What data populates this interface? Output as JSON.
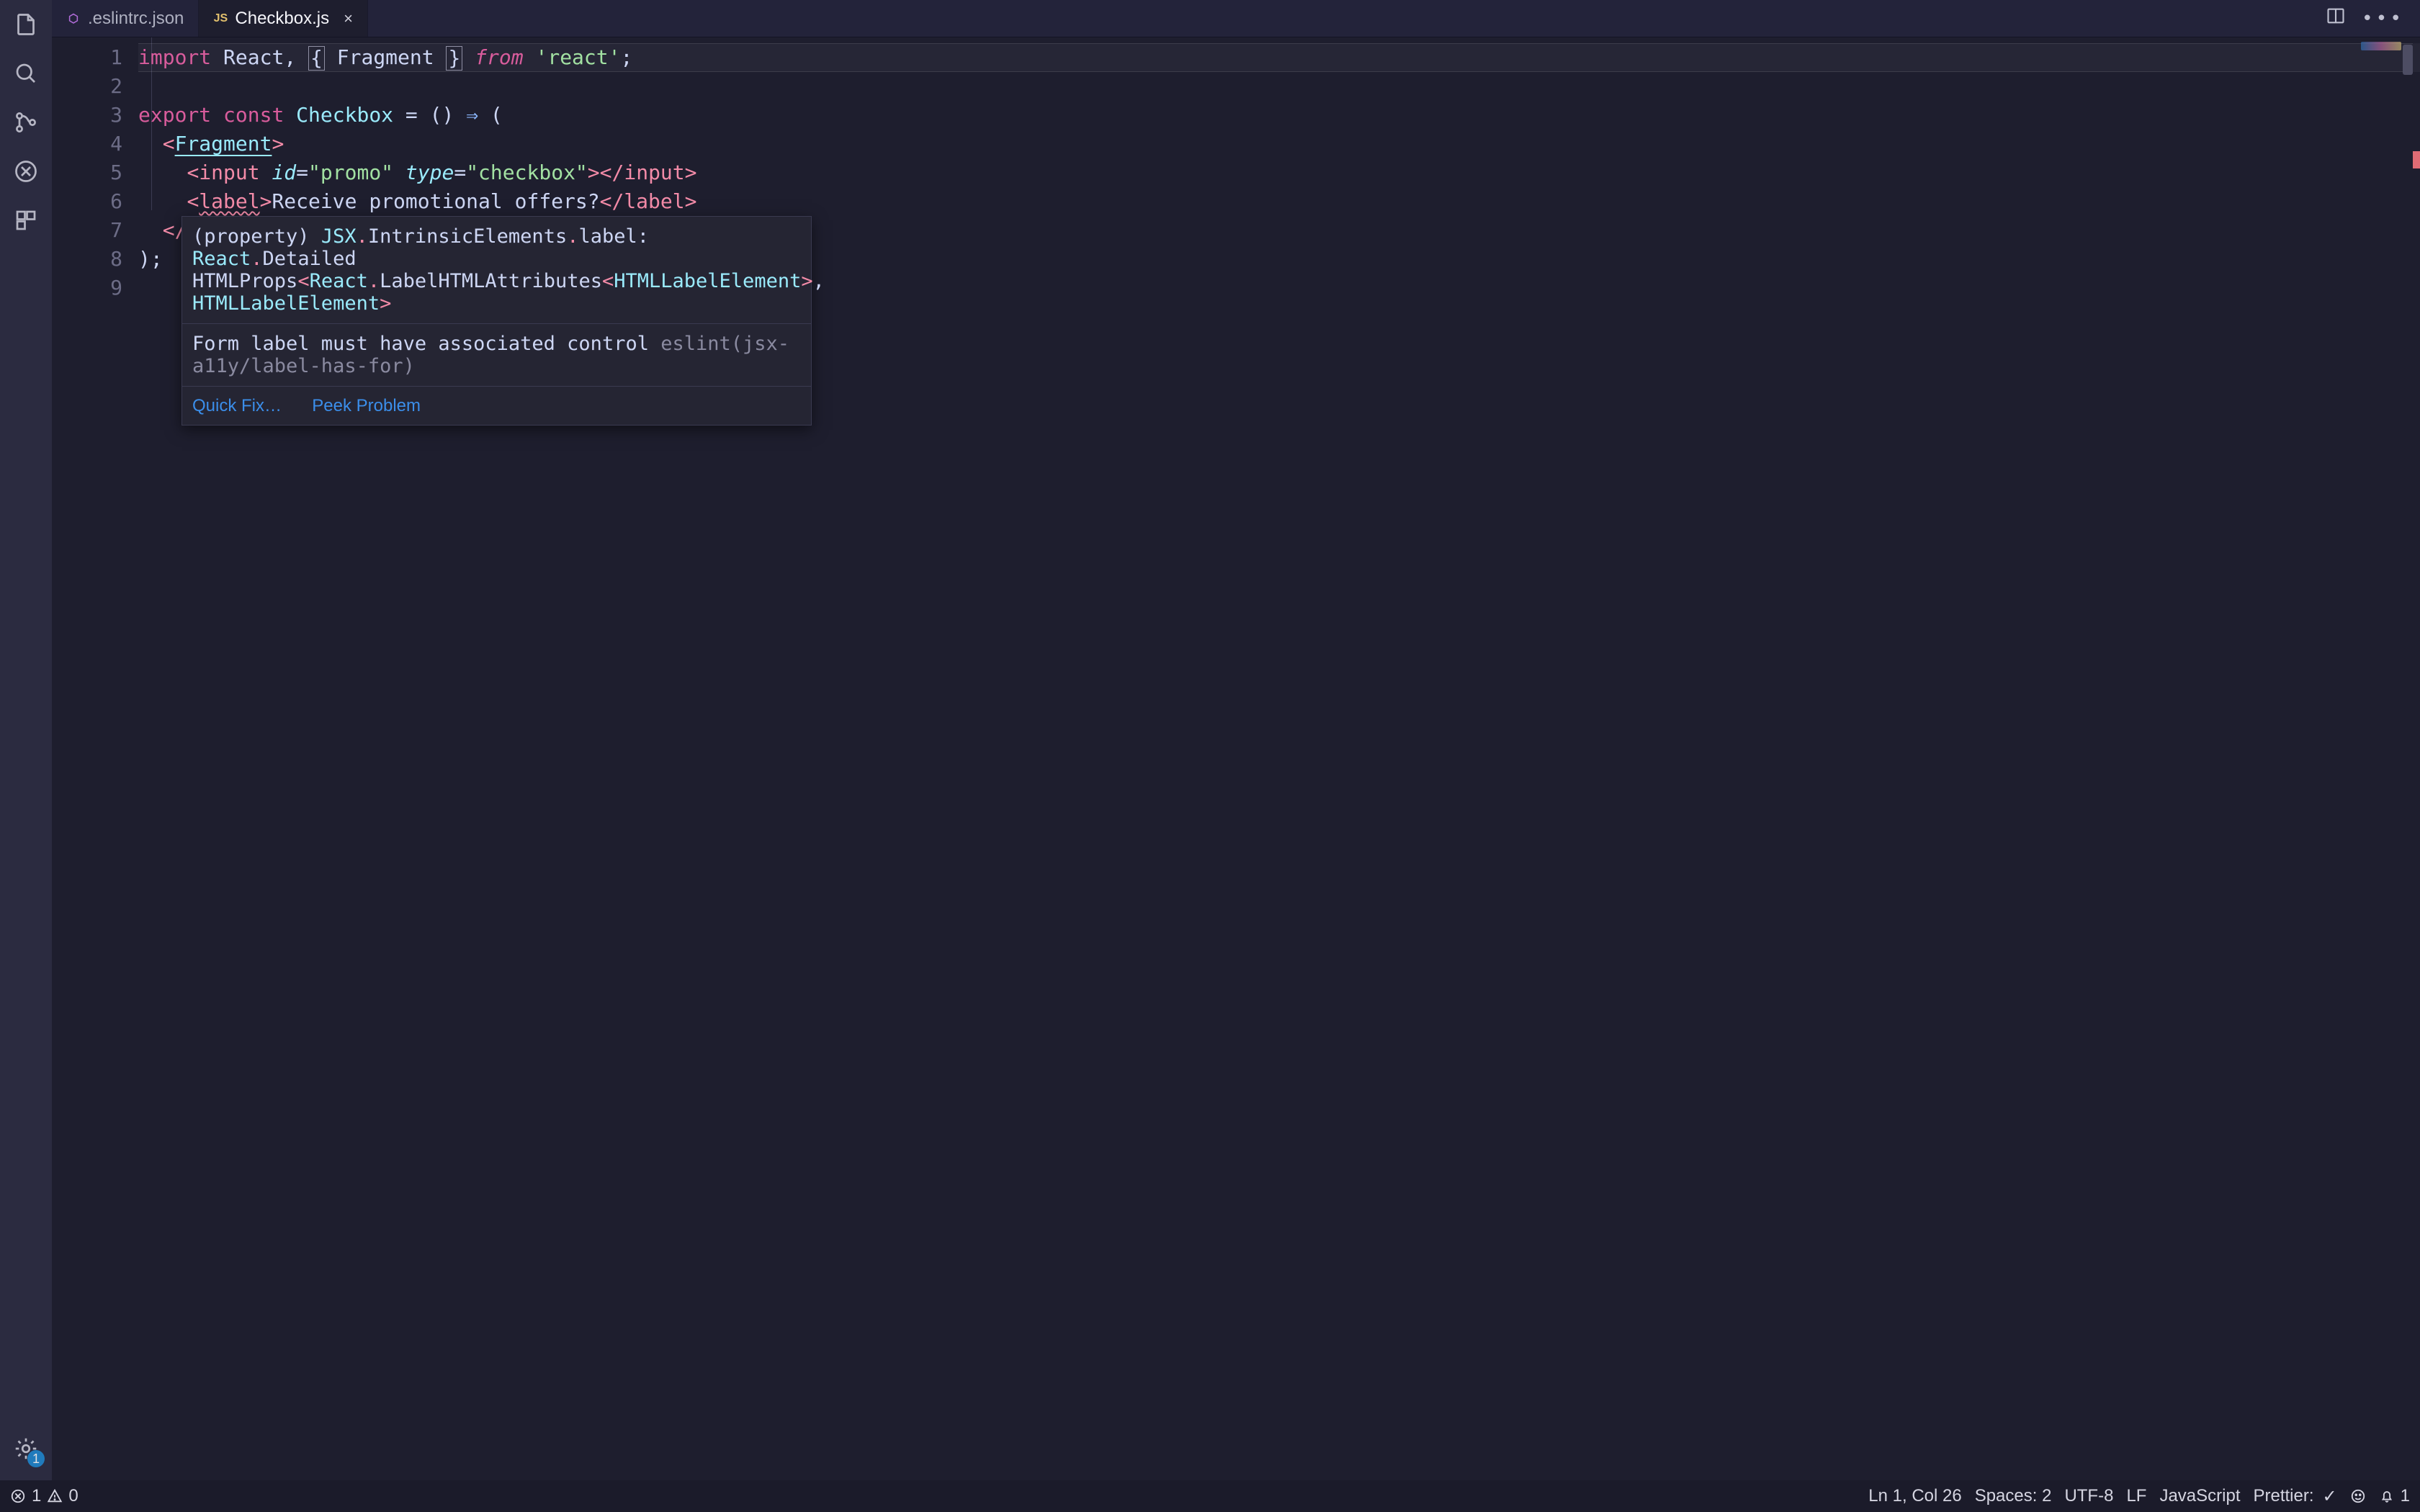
{
  "tabs": [
    {
      "label": ".eslintrc.json",
      "icon_color": "#b06cd8",
      "icon_text": "⬡",
      "active": false,
      "dirty": false
    },
    {
      "label": "Checkbox.js",
      "icon_color": "#e2c06d",
      "icon_text": "JS",
      "active": true,
      "dirty": false
    }
  ],
  "activity": {
    "settings_badge": "1"
  },
  "editor": {
    "line_numbers": [
      "1",
      "2",
      "3",
      "4",
      "5",
      "6",
      "7",
      "8",
      "9"
    ],
    "l1": {
      "import_kw": "import",
      "react": "React",
      "comma": ",",
      "lbrace": "{",
      "fragment": "Fragment",
      "rbrace": "}",
      "from_kw": "from",
      "react_str": "'react'",
      "semi": ";"
    },
    "l3": {
      "export_kw": "export",
      "const_kw": "const",
      "name": "Checkbox",
      "eq": "=",
      "lp": "(",
      "rp": ")",
      "arrow": "⇒",
      "open_p": "("
    },
    "l4": {
      "lt": "<",
      "frag": "Fragment",
      "gt": ">"
    },
    "l5": {
      "lt": "<",
      "tag": "input",
      "attr_id": "id",
      "eq": "=",
      "val_id": "\"promo\"",
      "attr_type": "type",
      "val_type": "\"checkbox\"",
      "gt": ">",
      "lt2": "</",
      "tag2": "input",
      "gt2": ">"
    },
    "l6": {
      "lt": "<",
      "tag": "label",
      "gt": ">",
      "text": "Receive promotional offers?",
      "lt2": "</",
      "tag2": "label",
      "gt2": ">"
    },
    "l7": {
      "lt": "</"
    },
    "l8": {
      "rp": ")",
      "semi": ";"
    }
  },
  "hover": {
    "sig_line1_a": "(property) ",
    "sig_line1_b": "JSX",
    "dot1": ".",
    "sig_line1_c": "IntrinsicElements",
    "dot2": ".",
    "sig_line1_d": "label",
    "colon": ": ",
    "sig_line1_e": "React",
    "dot3": ".",
    "sig_line1_f": "Detailed",
    "sig_line2_a": "HTMLProps",
    "lt": "<",
    "sig_line2_b": "React",
    "dot4": ".",
    "sig_line2_c": "LabelHTMLAttributes",
    "lt2": "<",
    "sig_line2_d": "HTMLLabelElement",
    "gt2": ">",
    "comma": ",",
    "sig_line3_a": " HTMLLabelElement",
    "gt": ">",
    "msg": "Form label must have associated control ",
    "rule": "eslint(jsx-a11y/label-has-for)",
    "quick_fix": "Quick Fix…",
    "peek": "Peek Problem"
  },
  "status": {
    "errors": "1",
    "warnings": "0",
    "ln_col": "Ln 1, Col 26",
    "spaces": "Spaces: 2",
    "encoding": "UTF-8",
    "eol": "LF",
    "lang": "JavaScript",
    "prettier": "Prettier:",
    "bell": "1"
  }
}
